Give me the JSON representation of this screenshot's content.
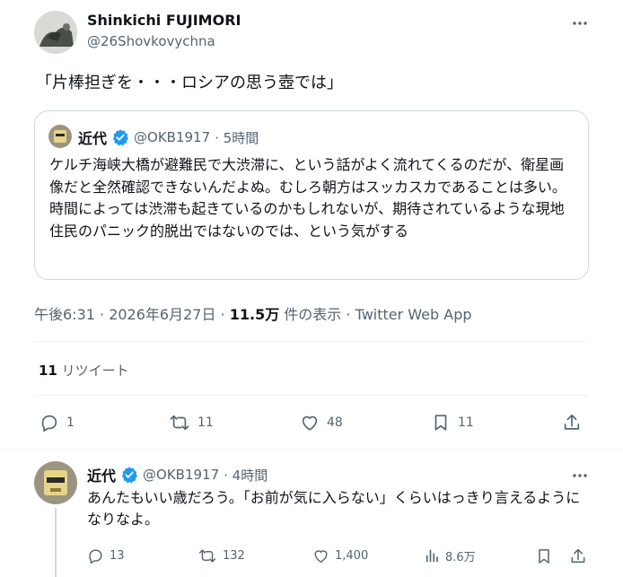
{
  "tweet": {
    "author_name": "Shinkichi FUJIMORI",
    "author_handle": "@26Shovkovychna",
    "text": "「片棒担ぎを・・・ロシアの思う壺では」",
    "quote": {
      "author_name": "近代",
      "author_handle": "@OKB1917",
      "time": "· 5時間",
      "text": "ケルチ海峡大橋が避難民で大渋滞に、という話がよく流れてくるのだが、衛星画像だと全然確認できないんだよぬ。むしろ朝方はスッカスカであることは多い。時間によっては渋滞も起きているのかもしれないが、期待されているような現地住民のパニック的脱出ではないのでは、という気がする"
    },
    "meta": {
      "datetime": "午後6:31 · 2026年6月27日 · ",
      "views": "11.5万",
      "views_label": " 件の表示 · ",
      "source": "Twitter Web App"
    },
    "retweets": {
      "count": "11",
      "label": " リツイート"
    },
    "actions": {
      "reply_count": "1",
      "retweet_count": "11",
      "like_count": "48",
      "bookmark_count": "11"
    }
  },
  "reply": {
    "author_name": "近代",
    "author_handle": "@OKB1917",
    "time": "· 4時間",
    "text": "あんたもいい歳だろう。「お前が気に入らない」くらいはっきり言えるようになりなよ。",
    "actions": {
      "reply_count": "13",
      "retweet_count": "132",
      "like_count": "1,400",
      "views_count": "8.6万"
    }
  },
  "colors": {
    "verified": "#1d9bf0",
    "muted": "#536471",
    "border": "#cfd9de",
    "divider": "#eff3f4"
  }
}
